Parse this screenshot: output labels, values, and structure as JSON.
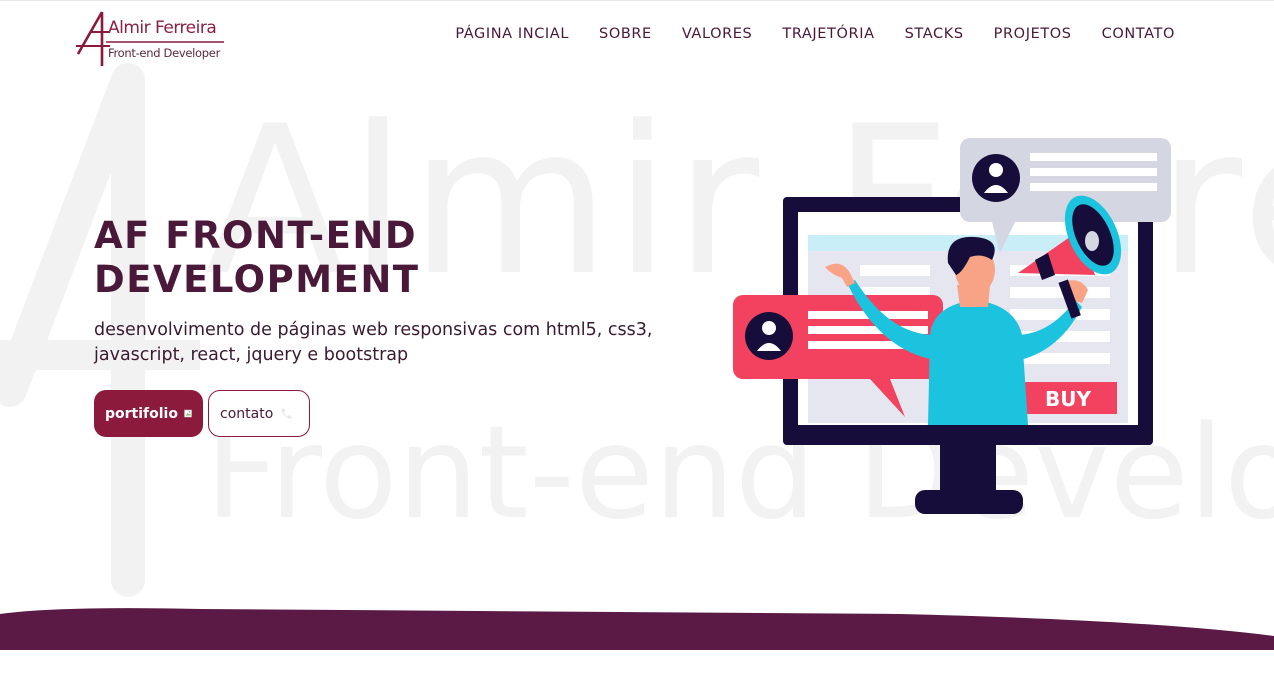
{
  "brand": {
    "name": "Almir Ferreira",
    "role": "Front-end Developer"
  },
  "nav": {
    "items": [
      {
        "label": "PÁGINA INCIAL"
      },
      {
        "label": "SOBRE"
      },
      {
        "label": "VALORES"
      },
      {
        "label": "TRAJETÓRIA"
      },
      {
        "label": "STACKS"
      },
      {
        "label": "PROJETOS"
      },
      {
        "label": "CONTATO"
      }
    ]
  },
  "watermark": {
    "line1": "Almir Ferreira",
    "line2": "Front-end Developer"
  },
  "hero": {
    "title_line1": "AF FRONT-END",
    "title_line2": "DEVELOPMENT",
    "subtitle_line1": "desenvolvimento de páginas web responsivas com html5, css3,",
    "subtitle_line2": "javascript, react, jquery e bootstrap",
    "buttons": {
      "primary_label": "portifolio",
      "secondary_label": "contato"
    }
  },
  "illustration": {
    "buy_label": "BUY"
  },
  "colors": {
    "accent": "#8c1a3d",
    "heading": "#4a1838",
    "wave": "#5a1a45",
    "bubble_red": "#f2425f",
    "bubble_gray": "#d4d6e2",
    "screen_dark": "#1a0e3a",
    "shirt": "#1cc3df"
  }
}
